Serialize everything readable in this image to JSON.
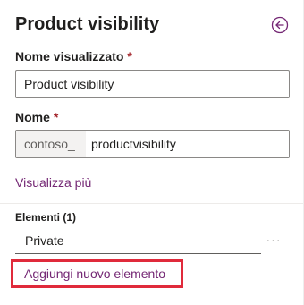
{
  "panel": {
    "title": "Product visibility",
    "back_icon": "circle-arrow-left-icon",
    "accent_color": "#742774"
  },
  "display_name": {
    "label": "Nome visualizzato",
    "required_mark": "*",
    "value": "Product visibility"
  },
  "name": {
    "label": "Nome",
    "required_mark": "*",
    "prefix": "contoso_",
    "value": "productvisibility"
  },
  "show_more": {
    "label": "Visualizza più"
  },
  "items_section": {
    "label": "Elementi (1)",
    "items": [
      {
        "value": "Private",
        "more_icon": "ellipsis-icon",
        "more_label": "···"
      }
    ],
    "add_label": "Aggiungi nuovo elemento",
    "highlight_color": "#e02a3b"
  }
}
